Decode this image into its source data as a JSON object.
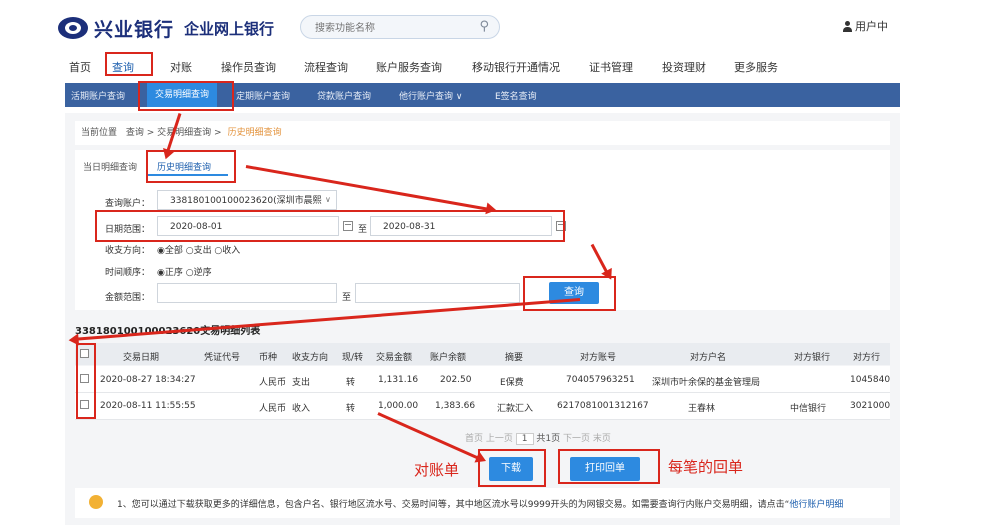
{
  "header": {
    "bank_name": "兴业银行",
    "portal_name": "企业网上银行",
    "search_placeholder": "搜索功能名称",
    "user_label": "用户中"
  },
  "main_nav": [
    "首页",
    "查询",
    "对账",
    "操作员查询",
    "流程查询",
    "账户服务查询",
    "移动银行开通情况",
    "证书管理",
    "投资理财",
    "更多服务"
  ],
  "sub_nav": [
    "活期账户查询",
    "交易明细查询",
    "定期账户查询",
    "贷款账户查询",
    "他行账户查询 ∨",
    "E签名查询"
  ],
  "breadcrumb": {
    "label": "当前位置",
    "path": "查询 > 交易明细查询 >",
    "current": "历史明细查询"
  },
  "tabs": [
    "当日明细查询",
    "历史明细查询"
  ],
  "form": {
    "account_label": "查询账户：",
    "account_value": "338180100100023620(深圳市晨熙",
    "date_label": "日期范围：",
    "date_from": "2020-08-01",
    "date_to_label": "至",
    "date_to": "2020-08-31",
    "direction_label": "收支方向：",
    "direction_options": "◉全部 ○支出 ○收入",
    "sort_label": "时间顺序：",
    "sort_options": "◉正序 ○逆序",
    "amount_label": "金额范围：",
    "amount_to_label": "至",
    "query_button": "查询"
  },
  "table": {
    "title": "338180100100023620交易明细列表",
    "headers": [
      "交易日期",
      "凭证代号",
      "币种",
      "收支方向",
      "现/转",
      "交易金额",
      "账户余额",
      "摘要",
      "对方账号",
      "对方户名",
      "对方银行",
      "对方行"
    ],
    "rows": [
      [
        "2020-08-27 18:34:27",
        "",
        "人民币",
        "支出",
        "转",
        "1,131.16",
        "202.50",
        "E保费",
        "704057963251",
        "深圳市叶余保的基金管理局",
        "",
        "1045840"
      ],
      [
        "2020-08-11 11:55:55",
        "",
        "人民币",
        "收入",
        "转",
        "1,000.00",
        "1,383.66",
        "汇款汇入",
        "6217081001312167",
        "王春林",
        "中信银行",
        "3021000"
      ]
    ]
  },
  "pager": {
    "first": "首页",
    "prev": "上一页",
    "page": "1",
    "total": "共1页",
    "next": "下一页",
    "last": "末页"
  },
  "actions": {
    "download": "下载",
    "print": "打印回单"
  },
  "annotations": {
    "download_note": "对账单",
    "print_note": "每笔的回单"
  },
  "notice": {
    "text": "1、您可以通过下载获取更多的详细信息，包含户名、银行地区流水号、交易时间等，其中地区流水号以9999开头的为网银交易。如需要查询行内账户交易明细，请点击“",
    "link": "他行账户明细"
  },
  "colors": {
    "brand": "#1c2f7a",
    "subnav": "#3a62a0",
    "accent": "#2d8ae0",
    "annotation": "#d9261c"
  }
}
